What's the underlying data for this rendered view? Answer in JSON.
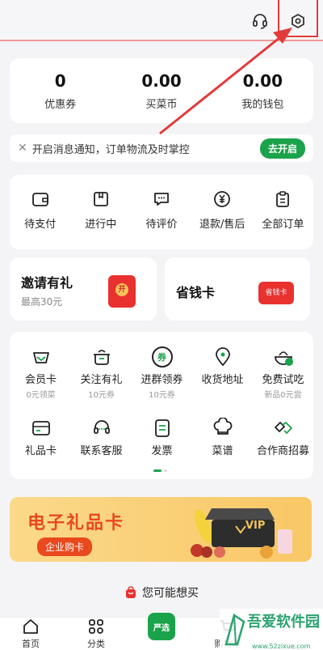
{
  "stats": [
    {
      "value": "0",
      "label": "优惠券"
    },
    {
      "value": "0.00",
      "label": "买菜币"
    },
    {
      "value": "0.00",
      "label": "我的钱包"
    }
  ],
  "notice": {
    "text": "开启消息通知，订单物流及时掌控",
    "button": "去开启"
  },
  "orders": [
    "待支付",
    "进行中",
    "待评价",
    "退款/售后",
    "全部订单"
  ],
  "promos": {
    "invite": {
      "title": "邀请有礼",
      "sub": "最高30元",
      "icon_text": "开"
    },
    "save": {
      "title": "省钱卡",
      "icon_text": "省钱卡"
    }
  },
  "services": [
    {
      "label": "会员卡",
      "sub": "0元领菜"
    },
    {
      "label": "关注有礼",
      "sub": "10元券"
    },
    {
      "label": "进群领券",
      "sub": "10元券"
    },
    {
      "label": "收货地址",
      "sub": ""
    },
    {
      "label": "免费试吃",
      "sub": "新品0元尝"
    },
    {
      "label": "礼品卡",
      "sub": ""
    },
    {
      "label": "联系客服",
      "sub": ""
    },
    {
      "label": "发票",
      "sub": ""
    },
    {
      "label": "菜谱",
      "sub": ""
    },
    {
      "label": "合作商招募",
      "sub": ""
    }
  ],
  "coupon_badge": "券",
  "banner": {
    "title": "电子礼品卡",
    "button": "企业购卡",
    "vip_text": "VIP"
  },
  "maybe_buy": "您可能想买",
  "tabs": [
    "首页",
    "分类",
    "严选",
    "购物车"
  ],
  "watermark": {
    "title": "吾爱软件园",
    "url": "www.52zixue.com"
  },
  "colors": {
    "accent": "#1aa34a",
    "highlight": "#e23b3b",
    "banner_text": "#e8491d"
  }
}
